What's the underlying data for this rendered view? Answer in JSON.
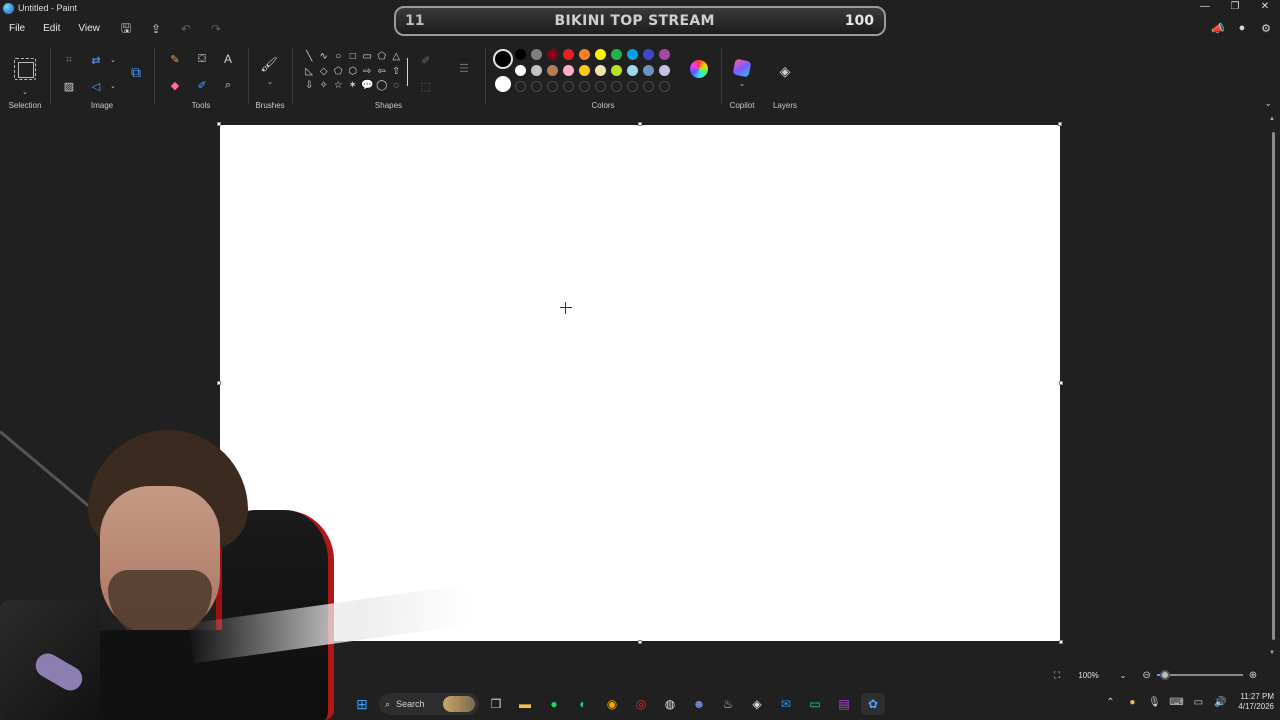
{
  "window": {
    "title": "Untitled - Paint",
    "controls": [
      "—",
      "❐",
      "✕"
    ]
  },
  "overlay": {
    "left_count": "11",
    "title": "BIKINI TOP STREAM",
    "right_count": "100"
  },
  "menu": {
    "file": "File",
    "edit": "Edit",
    "view": "View"
  },
  "ribbon": {
    "groups": {
      "selection": "Selection",
      "image": "Image",
      "tools": "Tools",
      "brushes": "Brushes",
      "shapes": "Shapes",
      "colors": "Colors",
      "copilot": "Copilot",
      "layers": "Layers"
    },
    "shapes": [
      "╲",
      "∿",
      "○",
      "□",
      "▭",
      "⬠",
      "△",
      "◺",
      "◇",
      "⬠",
      "⬡",
      "⇨",
      "⇦",
      "⇧",
      "⇩",
      "✧",
      "☆",
      "✶",
      "💬",
      "◯",
      "◌"
    ],
    "colors": {
      "primary": "#000000",
      "secondary": "#ffffff",
      "palette_row1": [
        "#000000",
        "#7f7f7f",
        "#880015",
        "#ed1c24",
        "#ff7f27",
        "#fff200",
        "#22b14c",
        "#00a2e8",
        "#3f48cc",
        "#a349a4"
      ],
      "palette_row2": [
        "#ffffff",
        "#c3c3c3",
        "#b97a57",
        "#ffaec9",
        "#ffc90e",
        "#efe4b0",
        "#b5e61d",
        "#99d9ea",
        "#7092be",
        "#c8bfe7"
      ],
      "custom_slots": 10
    }
  },
  "status": {
    "zoom": "100%",
    "zoom_fraction": 0.1
  },
  "taskbar": {
    "search_placeholder": "Search",
    "time": "11:27 PM",
    "date": "4/17/2026"
  }
}
